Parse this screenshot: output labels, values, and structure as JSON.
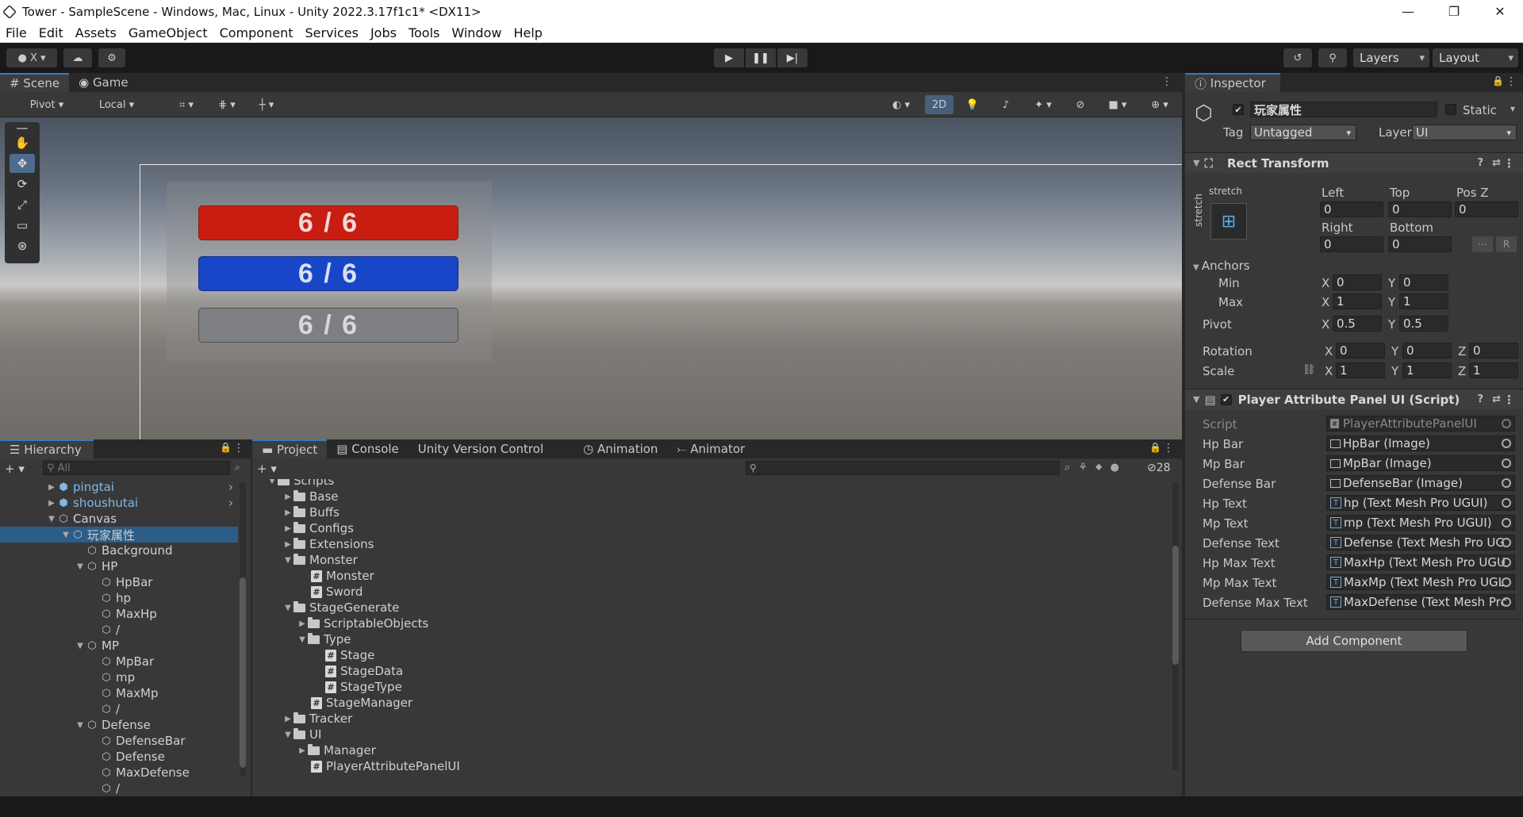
{
  "window": {
    "title": "Tower - SampleScene - Windows, Mac, Linux - Unity 2022.3.17f1c1* <DX11>"
  },
  "menu": [
    "File",
    "Edit",
    "Assets",
    "GameObject",
    "Component",
    "Services",
    "Jobs",
    "Tools",
    "Window",
    "Help"
  ],
  "toolbar": {
    "account_label": "X",
    "layers_label": "Layers",
    "layout_label": "Layout"
  },
  "scene": {
    "tabs": [
      "Scene",
      "Game"
    ],
    "pivot_label": "Pivot",
    "local_label": "Local",
    "mode_2d_label": "2D",
    "bars": {
      "hp": "6 / 6",
      "mp": "6 / 6",
      "defense": "6 / 6"
    }
  },
  "hierarchy": {
    "tab": "Hierarchy",
    "search_placeholder": "All",
    "rows": [
      {
        "label": "pingtai",
        "kind": "prefab",
        "arrow": "▶"
      },
      {
        "label": "shoushutai",
        "kind": "prefab",
        "arrow": "▶"
      },
      {
        "label": "Canvas",
        "kind": "object",
        "arrow": "▼"
      },
      {
        "label": "玩家属性",
        "kind": "object",
        "arrow": "▼",
        "selected": true
      },
      {
        "label": "Background",
        "kind": "object",
        "arrow": ""
      },
      {
        "label": "HP",
        "kind": "object",
        "arrow": "▼"
      },
      {
        "label": "HpBar",
        "kind": "object",
        "arrow": ""
      },
      {
        "label": "hp",
        "kind": "object",
        "arrow": ""
      },
      {
        "label": "MaxHp",
        "kind": "object",
        "arrow": ""
      },
      {
        "label": "/",
        "kind": "object",
        "arrow": ""
      },
      {
        "label": "MP",
        "kind": "object",
        "arrow": "▼"
      },
      {
        "label": "MpBar",
        "kind": "object",
        "arrow": ""
      },
      {
        "label": "mp",
        "kind": "object",
        "arrow": ""
      },
      {
        "label": "MaxMp",
        "kind": "object",
        "arrow": ""
      },
      {
        "label": "/",
        "kind": "object",
        "arrow": ""
      },
      {
        "label": "Defense",
        "kind": "object",
        "arrow": "▼"
      },
      {
        "label": "DefenseBar",
        "kind": "object",
        "arrow": ""
      },
      {
        "label": "Defense",
        "kind": "object",
        "arrow": ""
      },
      {
        "label": "MaxDefense",
        "kind": "object",
        "arrow": ""
      },
      {
        "label": "/",
        "kind": "object",
        "arrow": ""
      }
    ]
  },
  "project": {
    "tabs": [
      "Project",
      "Console",
      "Unity Version Control",
      "Animation",
      "Animator"
    ],
    "hidden_count": "28",
    "rows": [
      {
        "label": "Scripts",
        "kind": "folder",
        "arrow": "▼"
      },
      {
        "label": "Base",
        "kind": "folder",
        "arrow": "▶"
      },
      {
        "label": "Buffs",
        "kind": "folder",
        "arrow": "▶"
      },
      {
        "label": "Configs",
        "kind": "folder",
        "arrow": "▶"
      },
      {
        "label": "Extensions",
        "kind": "folder",
        "arrow": "▶"
      },
      {
        "label": "Monster",
        "kind": "folder",
        "arrow": "▼"
      },
      {
        "label": "Monster",
        "kind": "script",
        "arrow": ""
      },
      {
        "label": "Sword",
        "kind": "script",
        "arrow": ""
      },
      {
        "label": "StageGenerate",
        "kind": "folder",
        "arrow": "▼"
      },
      {
        "label": "ScriptableObjects",
        "kind": "folder",
        "arrow": "▶"
      },
      {
        "label": "Type",
        "kind": "folder",
        "arrow": "▼"
      },
      {
        "label": "Stage",
        "kind": "script",
        "arrow": ""
      },
      {
        "label": "StageData",
        "kind": "script",
        "arrow": ""
      },
      {
        "label": "StageType",
        "kind": "script",
        "arrow": ""
      },
      {
        "label": "StageManager",
        "kind": "script",
        "arrow": ""
      },
      {
        "label": "Tracker",
        "kind": "folder",
        "arrow": "▶"
      },
      {
        "label": "UI",
        "kind": "folder",
        "arrow": "▼"
      },
      {
        "label": "Manager",
        "kind": "folder",
        "arrow": "▶"
      },
      {
        "label": "PlayerAttributePanelUI",
        "kind": "script",
        "arrow": ""
      }
    ]
  },
  "inspector": {
    "tab": "Inspector",
    "object_name": "玩家属性",
    "static_label": "Static",
    "tag_label": "Tag",
    "tag_value": "Untagged",
    "layer_label": "Layer",
    "layer_value": "UI",
    "rect_transform": {
      "title": "Rect Transform",
      "stretch_label": "stretch",
      "left_label": "Left",
      "left": "0",
      "top_label": "Top",
      "top": "0",
      "posz_label": "Pos Z",
      "posz": "0",
      "right_label": "Right",
      "right": "0",
      "bottom_label": "Bottom",
      "bottom": "0",
      "r_button": "R",
      "anchors_label": "Anchors",
      "min_label": "Min",
      "min_x": "0",
      "min_y": "0",
      "max_label": "Max",
      "max_x": "1",
      "max_y": "1",
      "pivot_label": "Pivot",
      "pivot_x": "0.5",
      "pivot_y": "0.5",
      "rotation_label": "Rotation",
      "rot_x": "0",
      "rot_y": "0",
      "rot_z": "0",
      "scale_label": "Scale",
      "scale_x": "1",
      "scale_y": "1",
      "scale_z": "1",
      "x": "X",
      "y": "Y",
      "z": "Z"
    },
    "script_component": {
      "title": "Player Attribute Panel UI (Script)",
      "fields": [
        {
          "label": "Script",
          "value": "PlayerAttributePanelUI",
          "icon": "script"
        },
        {
          "label": "Hp Bar",
          "value": "HpBar (Image)",
          "icon": "image"
        },
        {
          "label": "Mp Bar",
          "value": "MpBar (Image)",
          "icon": "image"
        },
        {
          "label": "Defense Bar",
          "value": "DefenseBar (Image)",
          "icon": "image"
        },
        {
          "label": "Hp Text",
          "value": "hp (Text Mesh Pro UGUI)",
          "icon": "tmp"
        },
        {
          "label": "Mp Text",
          "value": "mp (Text Mesh Pro UGUI)",
          "icon": "tmp"
        },
        {
          "label": "Defense Text",
          "value": "Defense (Text Mesh Pro UG",
          "icon": "tmp"
        },
        {
          "label": "Hp Max Text",
          "value": "MaxHp (Text Mesh Pro UGU",
          "icon": "tmp"
        },
        {
          "label": "Mp Max Text",
          "value": "MaxMp (Text Mesh Pro UGL",
          "icon": "tmp"
        },
        {
          "label": "Defense Max Text",
          "value": "MaxDefense (Text Mesh Prc",
          "icon": "tmp"
        }
      ]
    },
    "add_component_label": "Add Component"
  }
}
